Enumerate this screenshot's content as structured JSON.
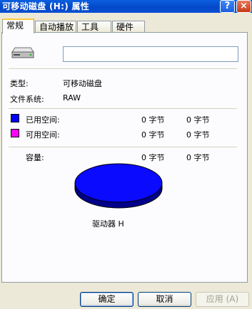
{
  "window": {
    "title": "可移动磁盘 (H:) 属性",
    "help_label": "?",
    "close_label": "×"
  },
  "tabs": [
    {
      "label": "常规",
      "active": true
    },
    {
      "label": "自动播放",
      "active": false
    },
    {
      "label": "工具",
      "active": false
    },
    {
      "label": "硬件",
      "active": false
    }
  ],
  "general": {
    "drive_name_value": "",
    "type_label": "类型:",
    "type_value": "可移动磁盘",
    "fs_label": "文件系统:",
    "fs_value": "RAW",
    "used_label": "已用空间:",
    "used_bytes": "0 字节",
    "used_size": "0 字节",
    "free_label": "可用空间:",
    "free_bytes": "0 字节",
    "free_size": "0 字节",
    "capacity_label": "容量:",
    "capacity_bytes": "0 字节",
    "capacity_size": "0 字节",
    "drive_caption": "驱动器 H"
  },
  "colors": {
    "used": "#0000ff",
    "free": "#ff00ff"
  },
  "buttons": {
    "ok": "确定",
    "cancel": "取消",
    "apply": "应用 (A)"
  }
}
